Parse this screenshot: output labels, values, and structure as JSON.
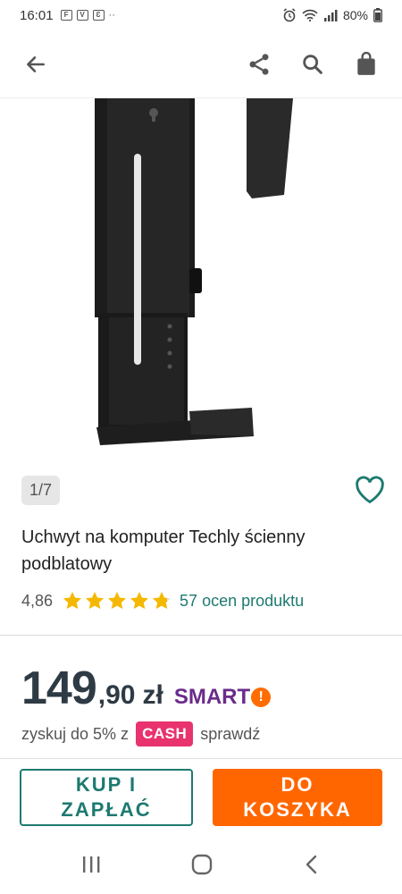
{
  "status_bar": {
    "time": "16:01",
    "battery": "80%",
    "left_extra": "··"
  },
  "app_bar": {
    "back_icon": "arrow-left-icon",
    "share_icon": "share-icon",
    "search_icon": "search-icon",
    "cart_icon": "shopping-bag-icon"
  },
  "gallery": {
    "counter": "1/7",
    "favorite_icon": "heart-outline-icon"
  },
  "product": {
    "title": "Uchwyt na komputer Techly ścienny podblatowy",
    "rating": "4,86",
    "stars": 4.86,
    "reviews": "57 ocen produktu"
  },
  "price": {
    "main": "149",
    "decimal": ",90",
    "currency": "zł",
    "smart_label": "SMART",
    "smart_mark": "!"
  },
  "cash": {
    "prefix": "zyskuj do 5% z",
    "badge": "CASH",
    "suffix": "sprawdź"
  },
  "actions": {
    "buy_now": "KUP I\nZAPŁAĆ",
    "add_to_cart": "DO\nKOSZYKA"
  },
  "colors": {
    "accent": "#1d7a70",
    "primary": "#ff6600",
    "star": "#f5b800",
    "price": "#2e3a44",
    "cash": "#e8336f",
    "smart": "#6a2b8a"
  }
}
